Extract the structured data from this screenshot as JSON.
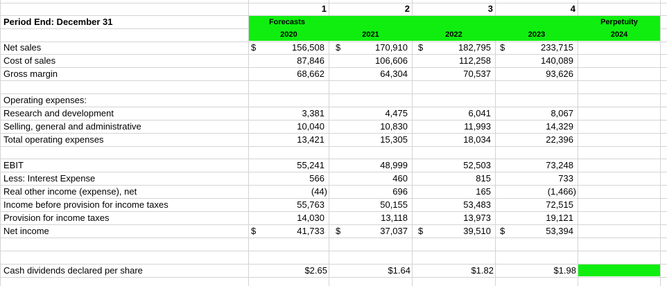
{
  "columns": [
    "1",
    "2",
    "3",
    "4"
  ],
  "header": {
    "period_label": "Period End: December 31",
    "forecasts_label": "Forecasts",
    "perpetuity_label": "Perpetuity",
    "years": [
      "2020",
      "2021",
      "2022",
      "2023"
    ],
    "perpetuity_year": "2024"
  },
  "currency_symbol": "$",
  "rows": {
    "net_sales": {
      "label": "Net sales",
      "values": [
        "156,508",
        "170,910",
        "182,795",
        "233,715"
      ]
    },
    "cost_of_sales": {
      "label": "Cost of sales",
      "values": [
        "87,846",
        "106,606",
        "112,258",
        "140,089"
      ]
    },
    "gross_margin": {
      "label": "Gross margin",
      "values": [
        "68,662",
        "64,304",
        "70,537",
        "93,626"
      ]
    },
    "opex_header": {
      "label": "Operating expenses:"
    },
    "rnd": {
      "label": "Research and development",
      "values": [
        "3,381",
        "4,475",
        "6,041",
        "8,067"
      ]
    },
    "sga": {
      "label": "Selling, general and administrative",
      "values": [
        "10,040",
        "10,830",
        "11,993",
        "14,329"
      ]
    },
    "total_opex": {
      "label": "Total operating expenses",
      "values": [
        "13,421",
        "15,305",
        "18,034",
        "22,396"
      ]
    },
    "ebit": {
      "label": "EBIT",
      "values": [
        "55,241",
        "48,999",
        "52,503",
        "73,248"
      ]
    },
    "interest": {
      "label": "Less: Interest Expense",
      "values": [
        "566",
        "460",
        "815",
        "733"
      ]
    },
    "other_income": {
      "label": "Real other income (expense), net",
      "values": [
        "(44)",
        "696",
        "165",
        "(1,466)"
      ]
    },
    "pretax": {
      "label": "Income before provision for income taxes",
      "values": [
        "55,763",
        "50,155",
        "53,483",
        "72,515"
      ]
    },
    "tax": {
      "label": "Provision for income taxes",
      "values": [
        "14,030",
        "13,118",
        "13,973",
        "19,121"
      ]
    },
    "net_income": {
      "label": "Net income",
      "values": [
        "41,733",
        "37,037",
        "39,510",
        "53,394"
      ]
    },
    "dividends": {
      "label": "Cash dividends declared per share",
      "values": [
        "$2.65",
        "$1.64",
        "$1.82",
        "$1.98"
      ]
    }
  },
  "colors": {
    "highlight": "#10ee10",
    "gridline": "#d4d4d4"
  }
}
